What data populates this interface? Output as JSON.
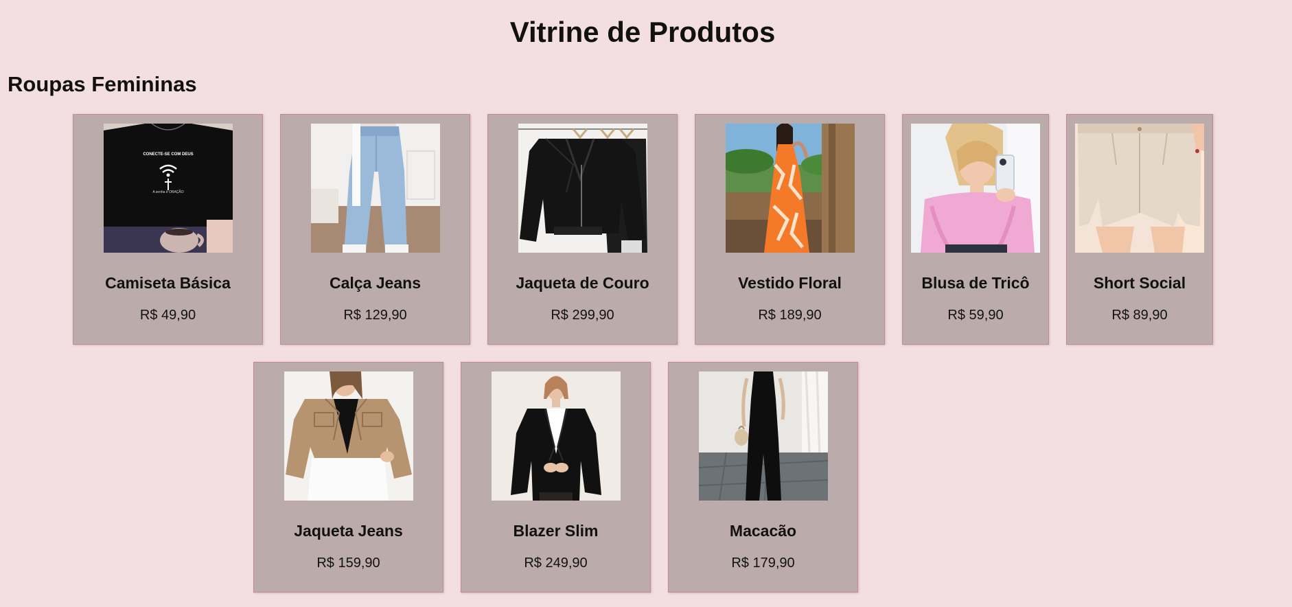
{
  "page": {
    "title": "Vitrine de Produtos"
  },
  "section": {
    "title": "Roupas Femininas"
  },
  "products": [
    {
      "name": "Camiseta Básica",
      "price": "R$ 49,90",
      "image": "black-tshirt-image",
      "tshirt_text": [
        "CONECTE-SE COM DEUS",
        "A senha é ORAÇÃO"
      ]
    },
    {
      "name": "Calça Jeans",
      "price": "R$ 129,90",
      "image": "wide-leg-jeans-image"
    },
    {
      "name": "Jaqueta de Couro",
      "price": "R$ 299,90",
      "image": "leather-jacket-image"
    },
    {
      "name": "Vestido Floral",
      "price": "R$ 189,90",
      "image": "floral-dress-image"
    },
    {
      "name": "Blusa de Tricô",
      "price": "R$ 59,90",
      "image": "pink-knit-sweater-image"
    },
    {
      "name": "Short Social",
      "price": "R$ 89,90",
      "image": "linen-shorts-image"
    },
    {
      "name": "Jaqueta Jeans",
      "price": "R$ 159,90",
      "image": "tan-denim-jacket-image"
    },
    {
      "name": "Blazer Slim",
      "price": "R$ 249,90",
      "image": "black-blazer-image"
    },
    {
      "name": "Macacão",
      "price": "R$ 179,90",
      "image": "black-jumpsuit-image"
    }
  ],
  "colors": {
    "background": "#f3dfe1",
    "card": "#bcabab",
    "card_border": "#c28a94"
  }
}
